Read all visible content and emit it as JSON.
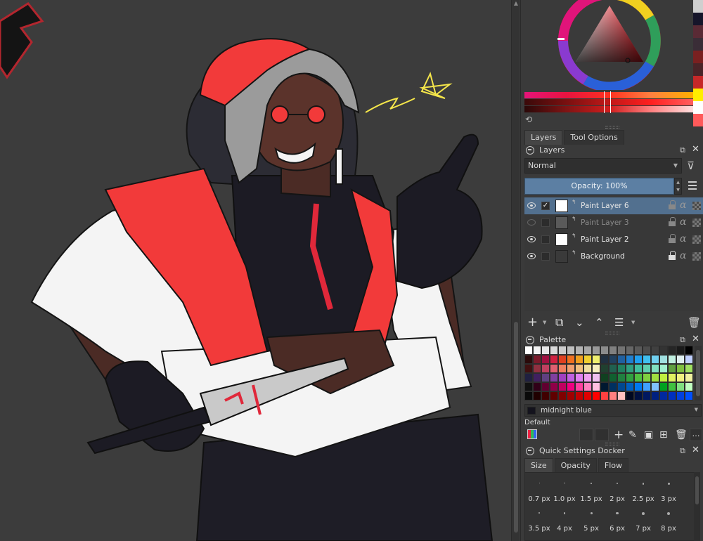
{
  "colors": {
    "accent": "#5c7fa3",
    "selection": "#52708f",
    "history_swatches": [
      "#cfcfcf",
      "#16152a",
      "#5a2a35",
      "#3a2d37",
      "#7a2020",
      "#4a2428",
      "#c62828",
      "#ffee00",
      "#ffffff",
      "#ff5a5a"
    ]
  },
  "color_selector": {
    "refresh_icon": "refresh-icon"
  },
  "tabs": {
    "layers": "Layers",
    "tool_options": "Tool Options"
  },
  "layers_docker": {
    "title": "Layers",
    "blend_mode": "Normal",
    "opacity_label": "Opacity:  100%",
    "layers": [
      {
        "name": "Paint Layer 6",
        "visible": true,
        "selected": true,
        "checked": true,
        "locked": false
      },
      {
        "name": "Paint Layer 3",
        "visible": false,
        "selected": false,
        "checked": false,
        "locked": false
      },
      {
        "name": "Paint Layer 2",
        "visible": true,
        "selected": false,
        "checked": false,
        "locked": false
      },
      {
        "name": "Background",
        "visible": true,
        "selected": false,
        "checked": false,
        "locked": true
      }
    ]
  },
  "palette_docker": {
    "title": "Palette",
    "selected_color_name": "midnight blue",
    "palette_name": "Default"
  },
  "quick_settings": {
    "title": "Quick Settings Docker",
    "tabs": [
      "Size",
      "Opacity",
      "Flow"
    ],
    "sizes_row1": [
      "0.7 px",
      "1.0 px",
      "1.5 px",
      "2 px",
      "2.5 px",
      "3 px"
    ],
    "sizes_row2": [
      "3.5 px",
      "4 px",
      "5 px",
      "6 px",
      "7 px",
      "8 px"
    ]
  }
}
